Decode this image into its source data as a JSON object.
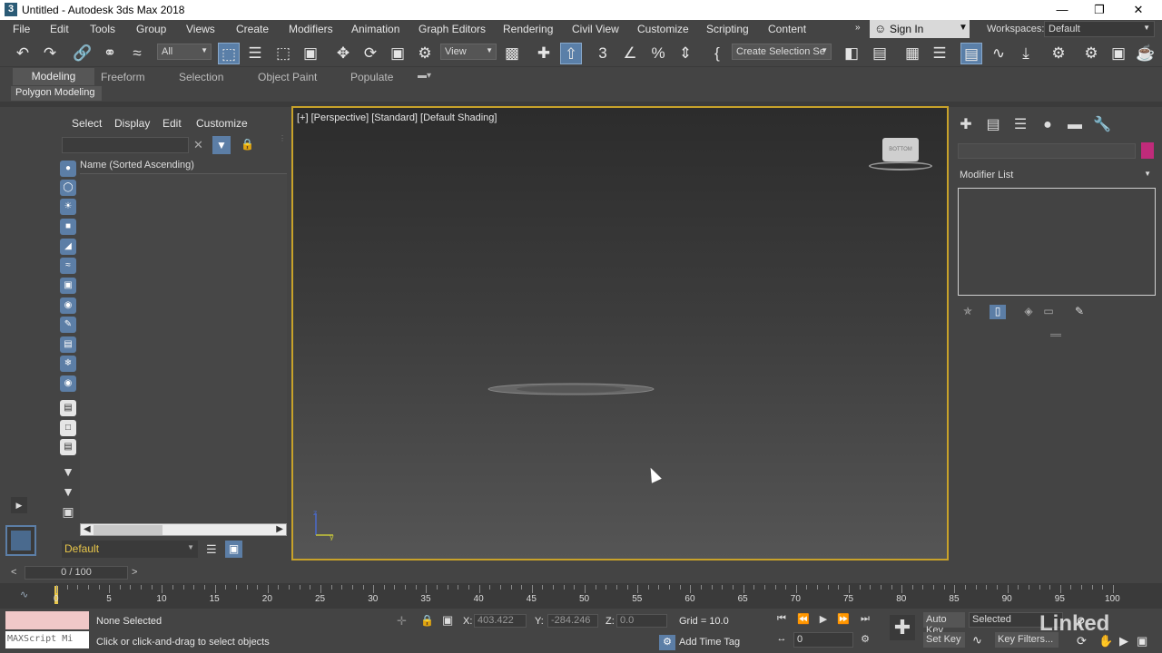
{
  "window": {
    "icon": "3",
    "title": "Untitled - Autodesk 3ds Max 2018",
    "controls": [
      "—",
      "❐",
      "✕"
    ]
  },
  "menu": [
    "File",
    "Edit",
    "Tools",
    "Group",
    "Views",
    "Create",
    "Modifiers",
    "Animation",
    "Graph Editors",
    "Rendering",
    "Civil View",
    "Customize",
    "Scripting",
    "Content"
  ],
  "account": {
    "sign_in": "Sign In",
    "workspaces_label": "Workspaces:",
    "workspace": "Default"
  },
  "toolbar": {
    "selection_filter": "All",
    "reference_coord": "View",
    "named_selection": "Create Selection Se"
  },
  "ribbon": {
    "tabs": [
      "Modeling",
      "Freeform",
      "Selection",
      "Object Paint",
      "Populate"
    ],
    "active_group": "Polygon Modeling"
  },
  "scene_explorer": {
    "menu": [
      "Select",
      "Display",
      "Edit",
      "Customize"
    ],
    "column_header": "Name (Sorted Ascending)",
    "layer": "Default"
  },
  "viewport": {
    "label": "[+] [Perspective] [Standard] [Default Shading]",
    "viewcube_text": "BOTTOM"
  },
  "command_panel": {
    "modifier_list": "Modifier List",
    "object_color": "#c02b7a"
  },
  "timeline": {
    "frame_display": "0 / 100",
    "ticks": [
      "0",
      "5",
      "10",
      "15",
      "20",
      "25",
      "30",
      "35",
      "40",
      "45",
      "50",
      "55",
      "60",
      "65",
      "70",
      "75",
      "80",
      "85",
      "90",
      "95",
      "100"
    ]
  },
  "status": {
    "maxscript": "MAXScript Mi",
    "selection": "None Selected",
    "prompt": "Click or click-and-drag to select objects",
    "x_label": "X:",
    "x_value": "403.422",
    "y_label": "Y:",
    "y_value": "-284.246",
    "z_label": "Z:",
    "z_value": "0.0",
    "grid": "Grid = 10.0",
    "add_time_tag": "Add Time Tag",
    "auto_key": "Auto Key",
    "set_key": "Set Key",
    "key_mode": "Selected",
    "key_filters": "Key Filters...",
    "current_frame": "0"
  },
  "watermark": "Linked"
}
